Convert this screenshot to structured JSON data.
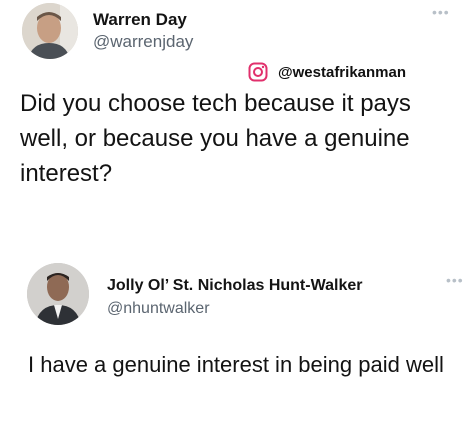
{
  "tweets": [
    {
      "author_name": "Warren Day",
      "author_handle": "@warrenjday",
      "more_icon": "more-dots-icon",
      "watermark": {
        "icon": "instagram-icon",
        "handle": "@westafrikanman"
      },
      "text": "Did you choose tech because it pays well, or because you have a genuine interest?"
    },
    {
      "author_name": "Jolly Ol’ St. Nicholas Hunt-Walker",
      "author_handle": "@nhuntwalker",
      "more_icon": "more-dots-icon",
      "text": "I have a genuine interest in being paid well"
    }
  ],
  "colors": {
    "text": "#131313",
    "handle": "#5b6570",
    "dots": "#b8c0c8",
    "instagram": "#e1306c"
  }
}
